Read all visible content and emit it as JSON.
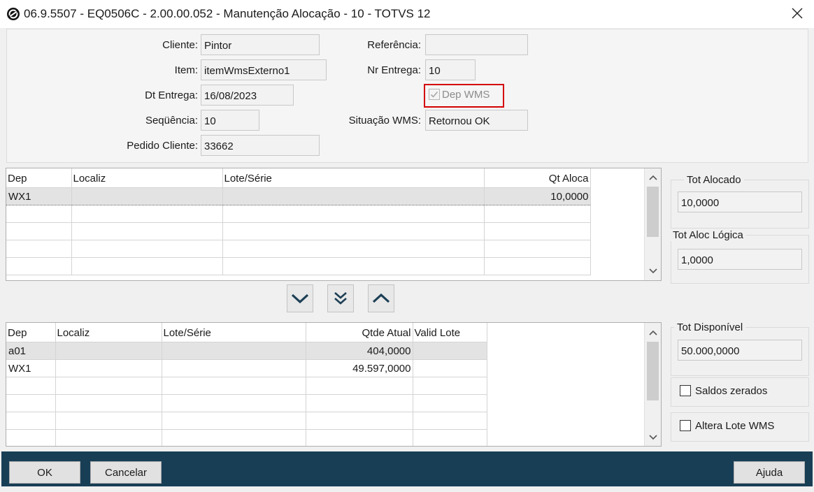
{
  "window": {
    "title": "06.9.5507 - EQ0506C - 2.00.00.052 - Manutenção Alocação - 10 - TOTVS 12"
  },
  "form": {
    "cliente": {
      "label": "Cliente:",
      "value": "Pintor"
    },
    "item": {
      "label": "Item:",
      "value": "itemWmsExterno1"
    },
    "dt_entrega": {
      "label": "Dt Entrega:",
      "value": "16/08/2023"
    },
    "sequencia": {
      "label": "Seqüência:",
      "value": "10"
    },
    "pedido_cliente": {
      "label": "Pedido Cliente:",
      "value": "33662"
    },
    "referencia": {
      "label": "Referência:",
      "value": ""
    },
    "nr_entrega": {
      "label": "Nr Entrega:",
      "value": "10"
    },
    "dep_wms": {
      "label": "Dep WMS",
      "checked": true,
      "disabled": true
    },
    "situacao_wms": {
      "label": "Situação WMS:",
      "value": "Retornou OK"
    }
  },
  "alloc_grid": {
    "columns": [
      "Dep",
      "Localiz",
      "Lote/Série",
      "Qt Aloca"
    ],
    "rows": [
      [
        "WX1",
        "",
        "",
        "10,0000"
      ]
    ]
  },
  "avail_grid": {
    "columns": [
      "Dep",
      "Localiz",
      "Lote/Série",
      "Qtde Atual",
      "Valid Lote"
    ],
    "rows": [
      [
        "a01",
        "",
        "",
        "404,0000",
        ""
      ],
      [
        "WX1",
        "",
        "",
        "49.597,0000",
        ""
      ]
    ]
  },
  "totals": {
    "tot_alocado": {
      "label": "Tot Alocado",
      "value": "10,0000"
    },
    "tot_aloc_logica": {
      "label": "Tot Aloc Lógica",
      "value": "1,0000"
    },
    "tot_disponivel": {
      "label": "Tot Disponível",
      "value": "50.000,0000"
    }
  },
  "options": {
    "saldos_zerados": {
      "label": "Saldos zerados",
      "checked": false
    },
    "altera_lote_wms": {
      "label": "Altera Lote WMS",
      "checked": false
    }
  },
  "buttons": {
    "ok": "OK",
    "cancelar": "Cancelar",
    "ajuda": "Ajuda"
  },
  "icons": {
    "app": "totvs-logo-icon",
    "close": "close-icon",
    "move_down": "chevron-down-icon",
    "move_all_down": "double-chevron-down-icon",
    "move_up": "chevron-up-icon"
  },
  "colors": {
    "footer": "#183e55",
    "highlight": "#d40000"
  }
}
